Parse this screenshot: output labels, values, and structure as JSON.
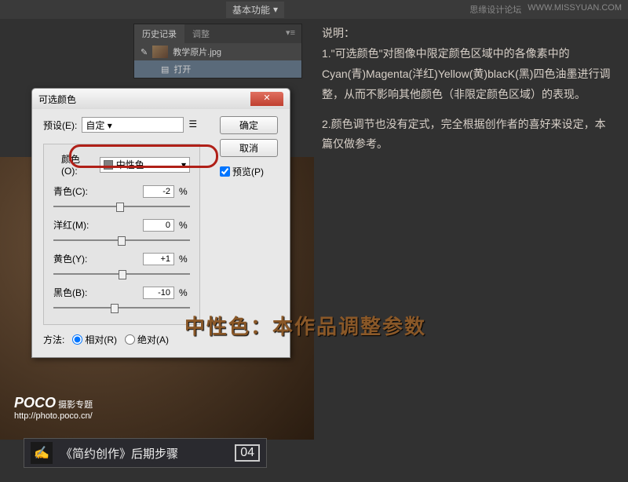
{
  "top": {
    "mode": "基本功能",
    "brand1": "思缘设计论坛",
    "brand2": "WWW.MISSYUAN.COM"
  },
  "history": {
    "tab1": "历史记录",
    "tab2": "调整",
    "item1": "教学原片.jpg",
    "item2": "打开"
  },
  "dialog": {
    "title": "可选颜色",
    "preset_label": "预设(E):",
    "preset_value": "自定",
    "ok": "确定",
    "cancel": "取消",
    "preview": "预览(P)",
    "color_label": "颜色(O):",
    "color_value": "中性色",
    "sliders": {
      "cyan": {
        "label": "青色(C):",
        "value": "-2"
      },
      "magenta": {
        "label": "洋红(M):",
        "value": "0"
      },
      "yellow": {
        "label": "黄色(Y):",
        "value": "+1"
      },
      "black": {
        "label": "黑色(B):",
        "value": "-10"
      }
    },
    "method_label": "方法:",
    "method_rel": "相对(R)",
    "method_abs": "绝对(A)",
    "pct": "%"
  },
  "explain": {
    "head": "说明：",
    "p1": "1.\"可选颜色\"对图像中限定颜色区域中的各像素中的Cyan(青)Magenta(洋红)Yellow(黄)blacK(黑)四色油墨进行调整，从而不影响其他颜色（非限定颜色区域）的表现。",
    "p2": "2.颜色调节也没有定式，完全根据创作者的喜好来设定，本篇仅做参考。"
  },
  "big_label": "中性色：本作品调整参数",
  "poco": {
    "brand": "POCO",
    "sub": "摄影专题",
    "url": "http://photo.poco.cn/"
  },
  "strip": {
    "title": "《简约创作》后期步骤",
    "num": "04"
  }
}
